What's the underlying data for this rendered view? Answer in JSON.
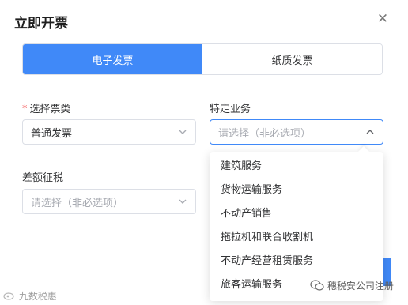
{
  "dialog": {
    "title": "立即开票",
    "close_icon": "close-icon"
  },
  "tabs": [
    {
      "label": "电子发票",
      "active": true
    },
    {
      "label": "纸质发票",
      "active": false
    }
  ],
  "form": {
    "invoice_type": {
      "label": "选择票类",
      "required_mark": "*",
      "value": "普通发票"
    },
    "special_business": {
      "label": "特定业务",
      "placeholder": "请选择（非必选项）"
    },
    "margin_tax": {
      "label": "差额征税",
      "placeholder": "请选择（非必选项）"
    }
  },
  "dropdown": {
    "options": [
      "建筑服务",
      "货物运输服务",
      "不动产销售",
      "拖拉机和联合收割机",
      "不动产经营租赁服务",
      "旅客运输服务"
    ]
  },
  "watermark": {
    "left": "九数税惠",
    "right": "穗税安公司注册"
  },
  "colors": {
    "primary": "#4089f8",
    "border": "#dcdfe6",
    "required": "#f56c6c",
    "placeholder": "#a8abb2"
  }
}
